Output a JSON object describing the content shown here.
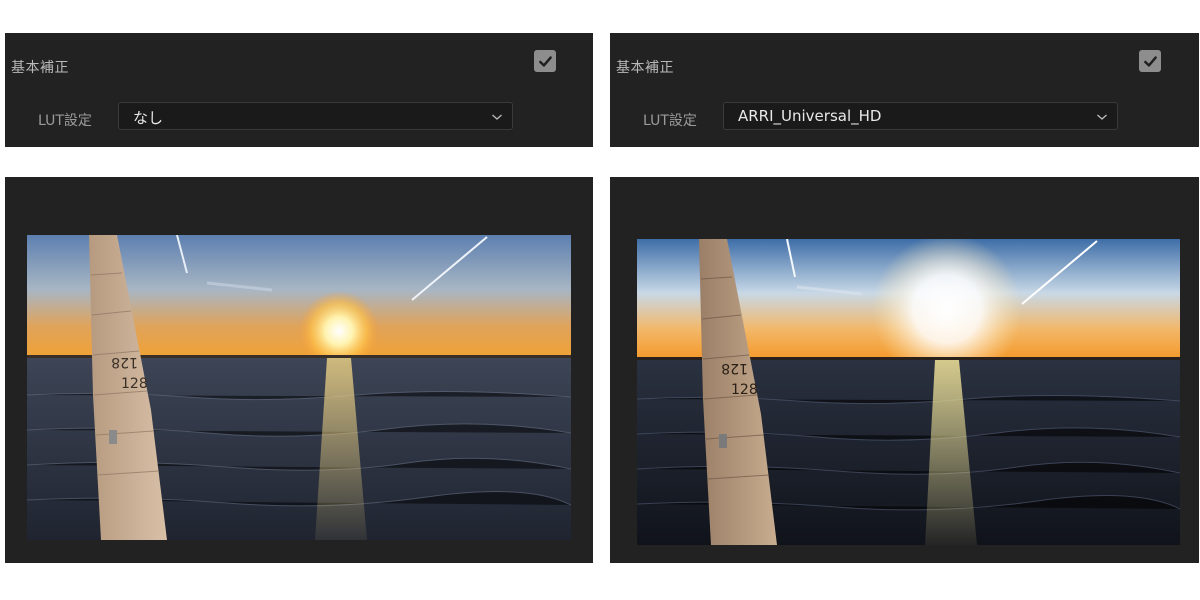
{
  "left": {
    "section_title": "基本補正",
    "lut_label": "LUT設定",
    "lut_value": "なし",
    "checked": true,
    "sail_numbers": "128"
  },
  "right": {
    "section_title": "基本補正",
    "lut_label": "LUT設定",
    "lut_value": "ARRI_Universal_HD",
    "checked": true,
    "sail_numbers": "128"
  },
  "icons": {
    "checkbox": "checkmark-icon",
    "dropdown": "chevron-down-icon"
  },
  "colors": {
    "panel_bg": "#222222",
    "select_bg": "#1a1a1a",
    "text_light": "#e8e8e8",
    "text_muted": "#b9b9b9"
  }
}
